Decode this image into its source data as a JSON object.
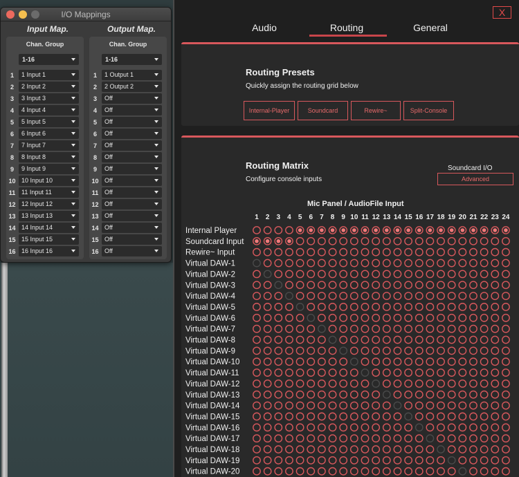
{
  "io_window": {
    "title": "I/O Mappings",
    "input_header": "Input Map.",
    "output_header": "Output Map.",
    "chan_group_label": "Chan. Group",
    "input_group": "1-16",
    "output_group": "1-16",
    "rows": [
      {
        "num": "1",
        "input": "1 Input 1",
        "output": "1 Output 1"
      },
      {
        "num": "2",
        "input": "2 Input 2",
        "output": "2 Output 2"
      },
      {
        "num": "3",
        "input": "3 Input 3",
        "output": "Off"
      },
      {
        "num": "4",
        "input": "4 Input 4",
        "output": "Off"
      },
      {
        "num": "5",
        "input": "5 Input 5",
        "output": "Off"
      },
      {
        "num": "6",
        "input": "6 Input 6",
        "output": "Off"
      },
      {
        "num": "7",
        "input": "7 Input 7",
        "output": "Off"
      },
      {
        "num": "8",
        "input": "8 Input 8",
        "output": "Off"
      },
      {
        "num": "9",
        "input": "9 Input 9",
        "output": "Off"
      },
      {
        "num": "10",
        "input": "10 Input 10",
        "output": "Off"
      },
      {
        "num": "11",
        "input": "11 Input 11",
        "output": "Off"
      },
      {
        "num": "12",
        "input": "12 Input 12",
        "output": "Off"
      },
      {
        "num": "13",
        "input": "13 Input 13",
        "output": "Off"
      },
      {
        "num": "14",
        "input": "14 Input 14",
        "output": "Off"
      },
      {
        "num": "15",
        "input": "15 Input 15",
        "output": "Off"
      },
      {
        "num": "16",
        "input": "16 Input 16",
        "output": "Off"
      }
    ]
  },
  "settings": {
    "close_label": "X",
    "tabs": [
      "Audio",
      "Routing",
      "General"
    ],
    "active_tab": "Routing",
    "presets": {
      "title": "Routing Presets",
      "subtitle": "Quickly assign the routing grid below",
      "buttons": [
        "Internal-Player",
        "Soundcard",
        "Rewire~",
        "Split-Console"
      ]
    },
    "matrix": {
      "title": "Routing Matrix",
      "subtitle": "Configure console inputs",
      "soundcard_io_label": "Soundcard I/O",
      "advanced_label": "Advanced",
      "column_header": "Mic Panel / AudioFile Input",
      "columns": [
        "1",
        "2",
        "3",
        "4",
        "5",
        "6",
        "7",
        "8",
        "9",
        "10",
        "11",
        "12",
        "13",
        "14",
        "15",
        "16",
        "17",
        "18",
        "19",
        "20",
        "21",
        "22",
        "23",
        "24"
      ],
      "rows": [
        "Internal Player",
        "Soundcard Input",
        "Rewire~ Input",
        "Virtual DAW-1",
        "Virtual DAW-2",
        "Virtual DAW-3",
        "Virtual DAW-4",
        "Virtual DAW-5",
        "Virtual DAW-6",
        "Virtual DAW-7",
        "Virtual DAW-8",
        "Virtual DAW-9",
        "Virtual DAW-10",
        "Virtual DAW-11",
        "Virtual DAW-12",
        "Virtual DAW-13",
        "Virtual DAW-14",
        "Virtual DAW-15",
        "Virtual DAW-16",
        "Virtual DAW-17",
        "Virtual DAW-18",
        "Virtual DAW-19",
        "Virtual DAW-20"
      ],
      "selected": {
        "Internal Player": [
          5,
          6,
          7,
          8,
          9,
          10,
          11,
          12,
          13,
          14,
          15,
          16,
          17,
          18,
          19,
          20,
          21,
          22,
          23,
          24
        ],
        "Soundcard Input": [
          1,
          2,
          3,
          4
        ]
      },
      "disabled_diagonal": true,
      "colors": {
        "ring": "#d8585c",
        "fill": "#f07a7a",
        "disabled": "#4a4a4a"
      }
    }
  }
}
